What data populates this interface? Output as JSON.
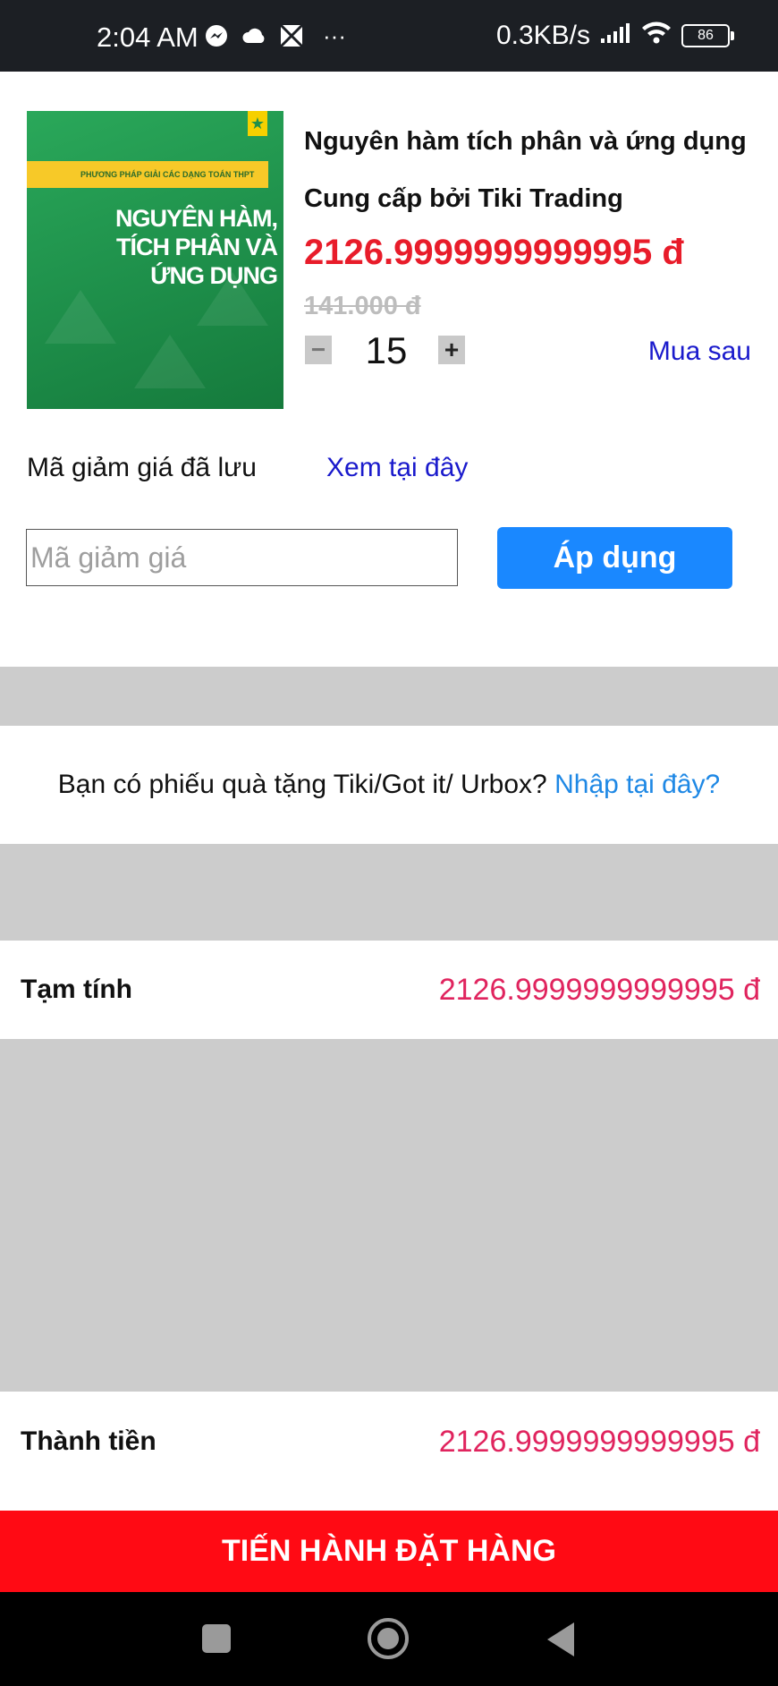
{
  "status_bar": {
    "time": "2:04 AM",
    "network_speed": "0.3KB/s",
    "battery": "86",
    "overflow": "···"
  },
  "product": {
    "cover_title": "NGUYÊN HÀM, TÍCH PHÂN VÀ ỨNG DỤNG",
    "cover_band": "PHƯƠNG PHÁP GIẢI CÁC DẠNG TOÁN THPT",
    "title": "Nguyên hàm tích phân và ứng dụng",
    "seller": "Cung cấp bởi Tiki Trading",
    "price": "2126.9999999999995 đ",
    "original_price": "141.000 đ",
    "quantity": "15",
    "minus_label": "−",
    "plus_label": "+",
    "buy_later": "Mua sau"
  },
  "coupon": {
    "saved_label": "Mã giảm giá đã lưu",
    "saved_link": "Xem tại đây",
    "input_placeholder": "Mã giảm giá",
    "apply_label": "Áp dụng"
  },
  "gift": {
    "text": "Bạn có phiếu quà tặng Tiki/Got it/ Urbox?",
    "link": "Nhập tại đây?"
  },
  "summary": {
    "subtotal_label": "Tạm tính",
    "subtotal_value": "2126.9999999999995 đ",
    "total_label": "Thành tiền",
    "total_value": "2126.9999999999995 đ"
  },
  "checkout_label": "TIẾN HÀNH ĐẶT HÀNG",
  "colors": {
    "price_red": "#e81c2a",
    "total_pink": "#e0245e",
    "apply_blue": "#1a88ff",
    "checkout_red": "#ff0a14"
  }
}
